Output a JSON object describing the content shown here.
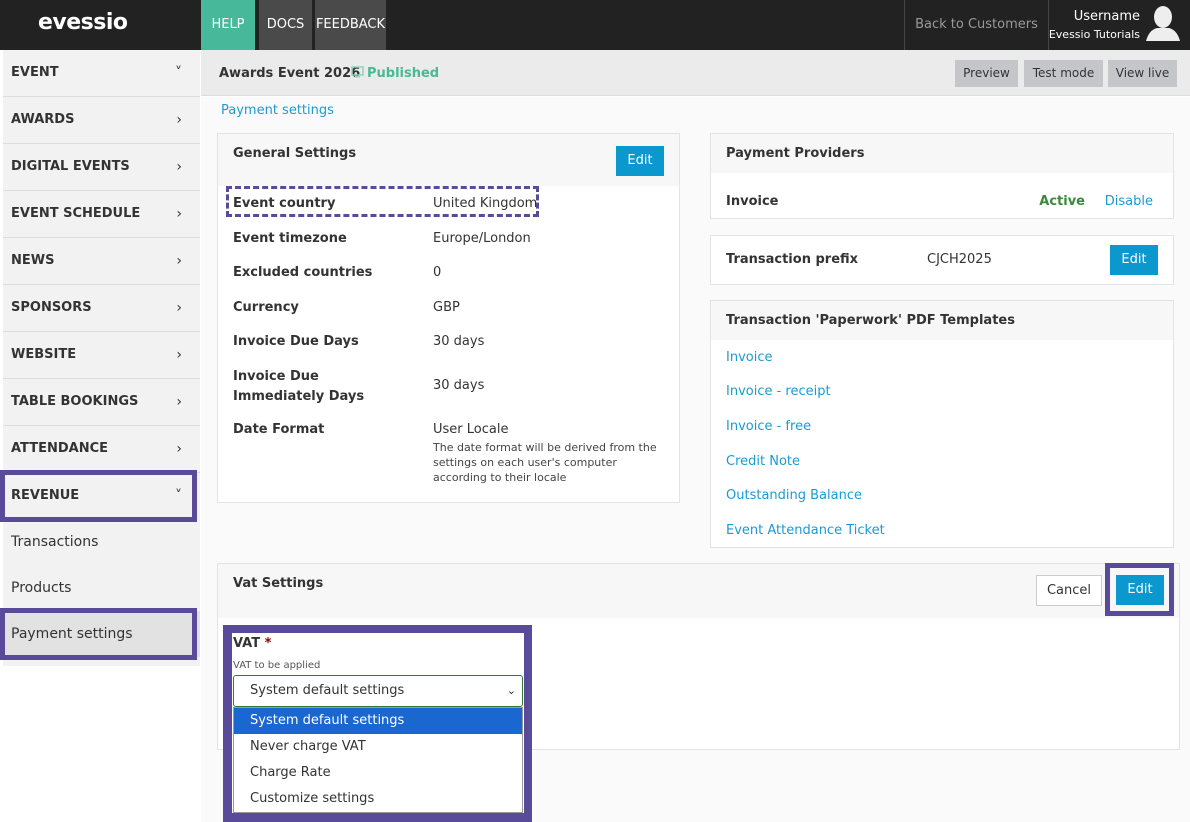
{
  "topbar": {
    "logo": "evessio",
    "tabs": [
      "HELP",
      "DOCS",
      "FEEDBACK"
    ],
    "back": "Back to Customers",
    "username": "Username",
    "org": "Evessio Tutorials"
  },
  "sidebar": {
    "items": [
      {
        "label": "EVENT",
        "chev": "˅"
      },
      {
        "label": "AWARDS",
        "chev": "›"
      },
      {
        "label": "DIGITAL EVENTS",
        "chev": "›"
      },
      {
        "label": "EVENT SCHEDULE",
        "chev": "›"
      },
      {
        "label": "NEWS",
        "chev": "›"
      },
      {
        "label": "SPONSORS",
        "chev": "›"
      },
      {
        "label": "WEBSITE",
        "chev": "›"
      },
      {
        "label": "TABLE BOOKINGS",
        "chev": "›"
      },
      {
        "label": "ATTENDANCE",
        "chev": "›"
      },
      {
        "label": "REVENUE",
        "chev": "˅"
      }
    ],
    "sub": [
      "Transactions",
      "Products",
      "Payment settings"
    ]
  },
  "header": {
    "title": "Awards Event 2026",
    "status": "Published",
    "buttons": [
      "Preview",
      "Test mode",
      "View live"
    ]
  },
  "breadcrumb": "Payment settings",
  "general": {
    "title": "General Settings",
    "edit": "Edit",
    "rows": [
      {
        "label": "Event country",
        "value": "United Kingdom"
      },
      {
        "label": "Event timezone",
        "value": "Europe/London"
      },
      {
        "label": "Excluded countries",
        "value": "0"
      },
      {
        "label": "Currency",
        "value": "GBP"
      },
      {
        "label": "Invoice Due Days",
        "value": "30 days"
      },
      {
        "label": "Invoice Due Immediately Days",
        "value": "30 days"
      },
      {
        "label": "Date Format",
        "value": "User Locale",
        "note": "The date format will be derived from the settings on each user's computer according to their locale"
      }
    ]
  },
  "providers": {
    "title": "Payment Providers",
    "name": "Invoice",
    "status": "Active",
    "action": "Disable"
  },
  "prefix": {
    "label": "Transaction prefix",
    "value": "CJCH2025",
    "edit": "Edit"
  },
  "templates": {
    "title": "Transaction 'Paperwork' PDF Templates",
    "items": [
      "Invoice",
      "Invoice - receipt",
      "Invoice - free",
      "Credit Note",
      "Outstanding Balance",
      "Event Attendance Ticket"
    ]
  },
  "vat": {
    "title": "Vat Settings",
    "cancel": "Cancel",
    "edit": "Edit",
    "label": "VAT",
    "required": "*",
    "help": "VAT to be applied",
    "selected": "System default settings",
    "options": [
      "System default settings",
      "Never charge VAT",
      "Charge Rate",
      "Customize settings"
    ]
  },
  "colors": {
    "accent": "#0a98cf",
    "highlight": "#5a4a9a",
    "green": "#48b89a"
  }
}
